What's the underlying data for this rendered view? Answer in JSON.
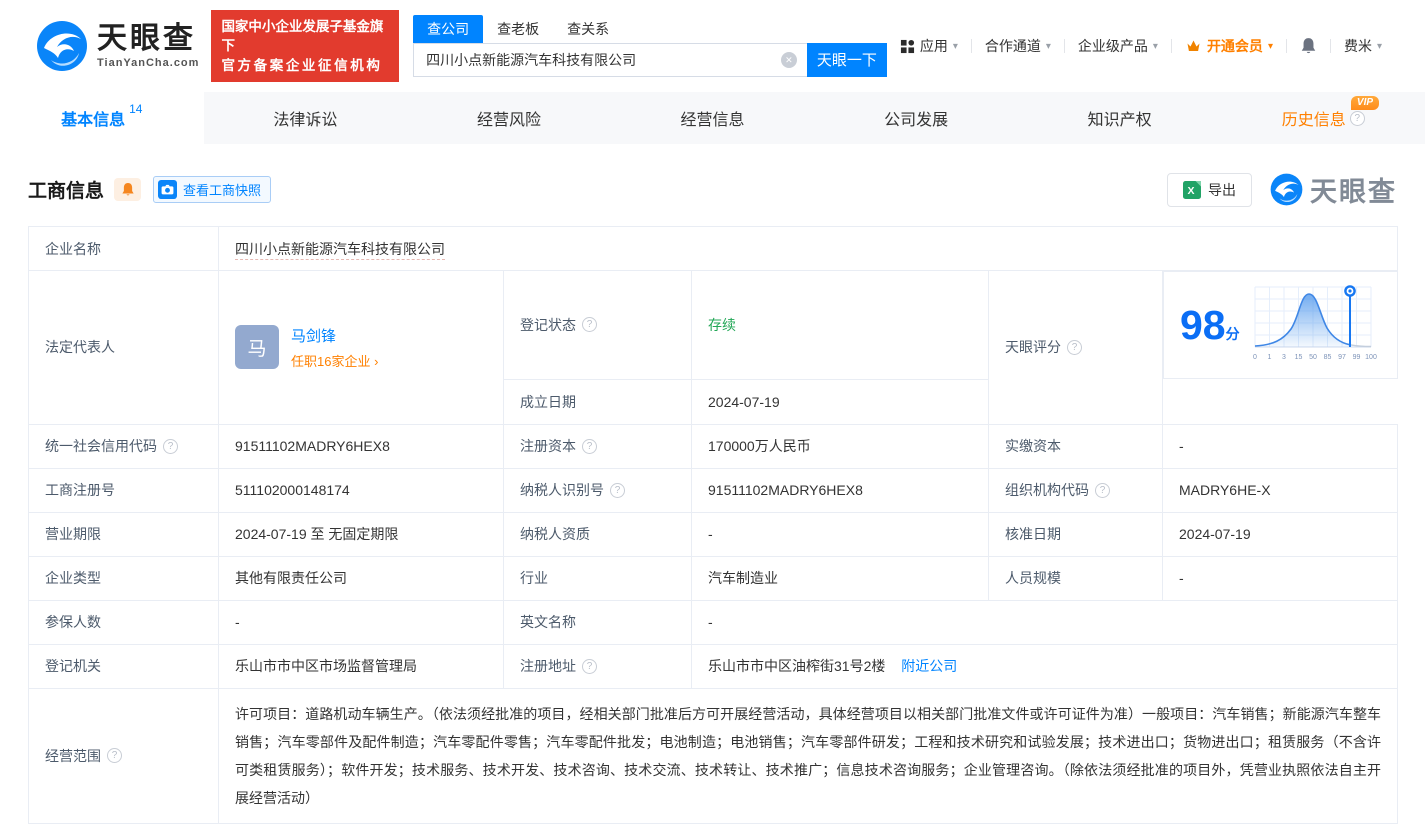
{
  "brand": {
    "logo_text": "天眼查",
    "logo_sub": "TianYanCha.com",
    "badge_line1": "国家中小企业发展子基金旗下",
    "badge_line2": "官方备案企业征信机构"
  },
  "icons": {
    "help": "?",
    "caret": "▾",
    "clear": "✕"
  },
  "search": {
    "tabs": [
      {
        "label": "查公司"
      },
      {
        "label": "查老板"
      },
      {
        "label": "查关系"
      }
    ],
    "value": "四川小点新能源汽车科技有限公司",
    "button_label": "天眼一下"
  },
  "menu": {
    "items": [
      {
        "label": "应用"
      },
      {
        "label": "合作通道"
      },
      {
        "label": "企业级产品"
      },
      {
        "label": "开通会员"
      },
      {
        "label": "费米"
      }
    ]
  },
  "nav_tabs": [
    {
      "label": "基本信息",
      "count": "14"
    },
    {
      "label": "法律诉讼"
    },
    {
      "label": "经营风险"
    },
    {
      "label": "经营信息"
    },
    {
      "label": "公司发展"
    },
    {
      "label": "知识产权"
    },
    {
      "label": "历史信息",
      "vip_badge": "VIP"
    }
  ],
  "section": {
    "title": "工商信息",
    "snapshot_button": "查看工商快照",
    "export_button": "导出",
    "watermark": "天眼查"
  },
  "fields": {
    "company_name": {
      "label": "企业名称",
      "value": "四川小点新能源汽车科技有限公司"
    },
    "legal_rep": {
      "label": "法定代表人",
      "avatar": "马",
      "name": "马剑锋",
      "link": "任职16家企业 ›"
    },
    "reg_status": {
      "label": "登记状态",
      "value": "存续"
    },
    "establish_date": {
      "label": "成立日期",
      "value": "2024-07-19"
    },
    "score": {
      "label": "天眼评分",
      "value": "98",
      "unit": "分"
    },
    "credit_code": {
      "label": "统一社会信用代码",
      "value": "91511102MADRY6HEX8"
    },
    "reg_capital": {
      "label": "注册资本",
      "value": "170000万人民币"
    },
    "paid_capital": {
      "label": "实缴资本",
      "value": "-"
    },
    "reg_number": {
      "label": "工商注册号",
      "value": "511102000148174"
    },
    "taxpayer_id": {
      "label": "纳税人识别号",
      "value": "91511102MADRY6HEX8"
    },
    "org_code": {
      "label": "组织机构代码",
      "value": "MADRY6HE-X"
    },
    "business_term": {
      "label": "营业期限",
      "value": "2024-07-19 至 无固定期限"
    },
    "taxpayer_quality": {
      "label": "纳税人资质",
      "value": "-"
    },
    "approval_date": {
      "label": "核准日期",
      "value": "2024-07-19"
    },
    "company_type": {
      "label": "企业类型",
      "value": "其他有限责任公司"
    },
    "industry": {
      "label": "行业",
      "value": "汽车制造业"
    },
    "staff_size": {
      "label": "人员规模",
      "value": "-"
    },
    "insured_count": {
      "label": "参保人数",
      "value": "-"
    },
    "english_name": {
      "label": "英文名称",
      "value": "-"
    },
    "reg_authority": {
      "label": "登记机关",
      "value": "乐山市市中区市场监督管理局"
    },
    "reg_address": {
      "label": "注册地址",
      "value": "乐山市市中区油榨街31号2楼",
      "link": "附近公司"
    },
    "business_scope": {
      "label": "经营范围",
      "value": "许可项目：道路机动车辆生产。（依法须经批准的项目，经相关部门批准后方可开展经营活动，具体经营项目以相关部门批准文件或许可证件为准）一般项目：汽车销售；新能源汽车整车销售；汽车零部件及配件制造；汽车零配件零售；汽车零配件批发；电池制造；电池销售；汽车零部件研发；工程和技术研究和试验发展；技术进出口；货物进出口；租赁服务（不含许可类租赁服务）；软件开发；技术服务、技术开发、技术咨询、技术交流、技术转让、技术推广；信息技术咨询服务；企业管理咨询。（除依法须经批准的项目外，凭营业执照依法自主开展经营活动）"
    }
  },
  "chart_data": {
    "type": "area",
    "title": "天眼评分分布曲线",
    "x_ticks": [
      "0",
      "1",
      "3",
      "15",
      "50",
      "85",
      "97",
      "99",
      "100"
    ],
    "marker_value": 98,
    "score": 98
  },
  "colors": {
    "brand_blue": "#0084ff",
    "vip_orange": "#ff8000",
    "badge_red": "#e23b2e",
    "status_green": "#23a757",
    "score_blue": "#0b6ef5"
  }
}
